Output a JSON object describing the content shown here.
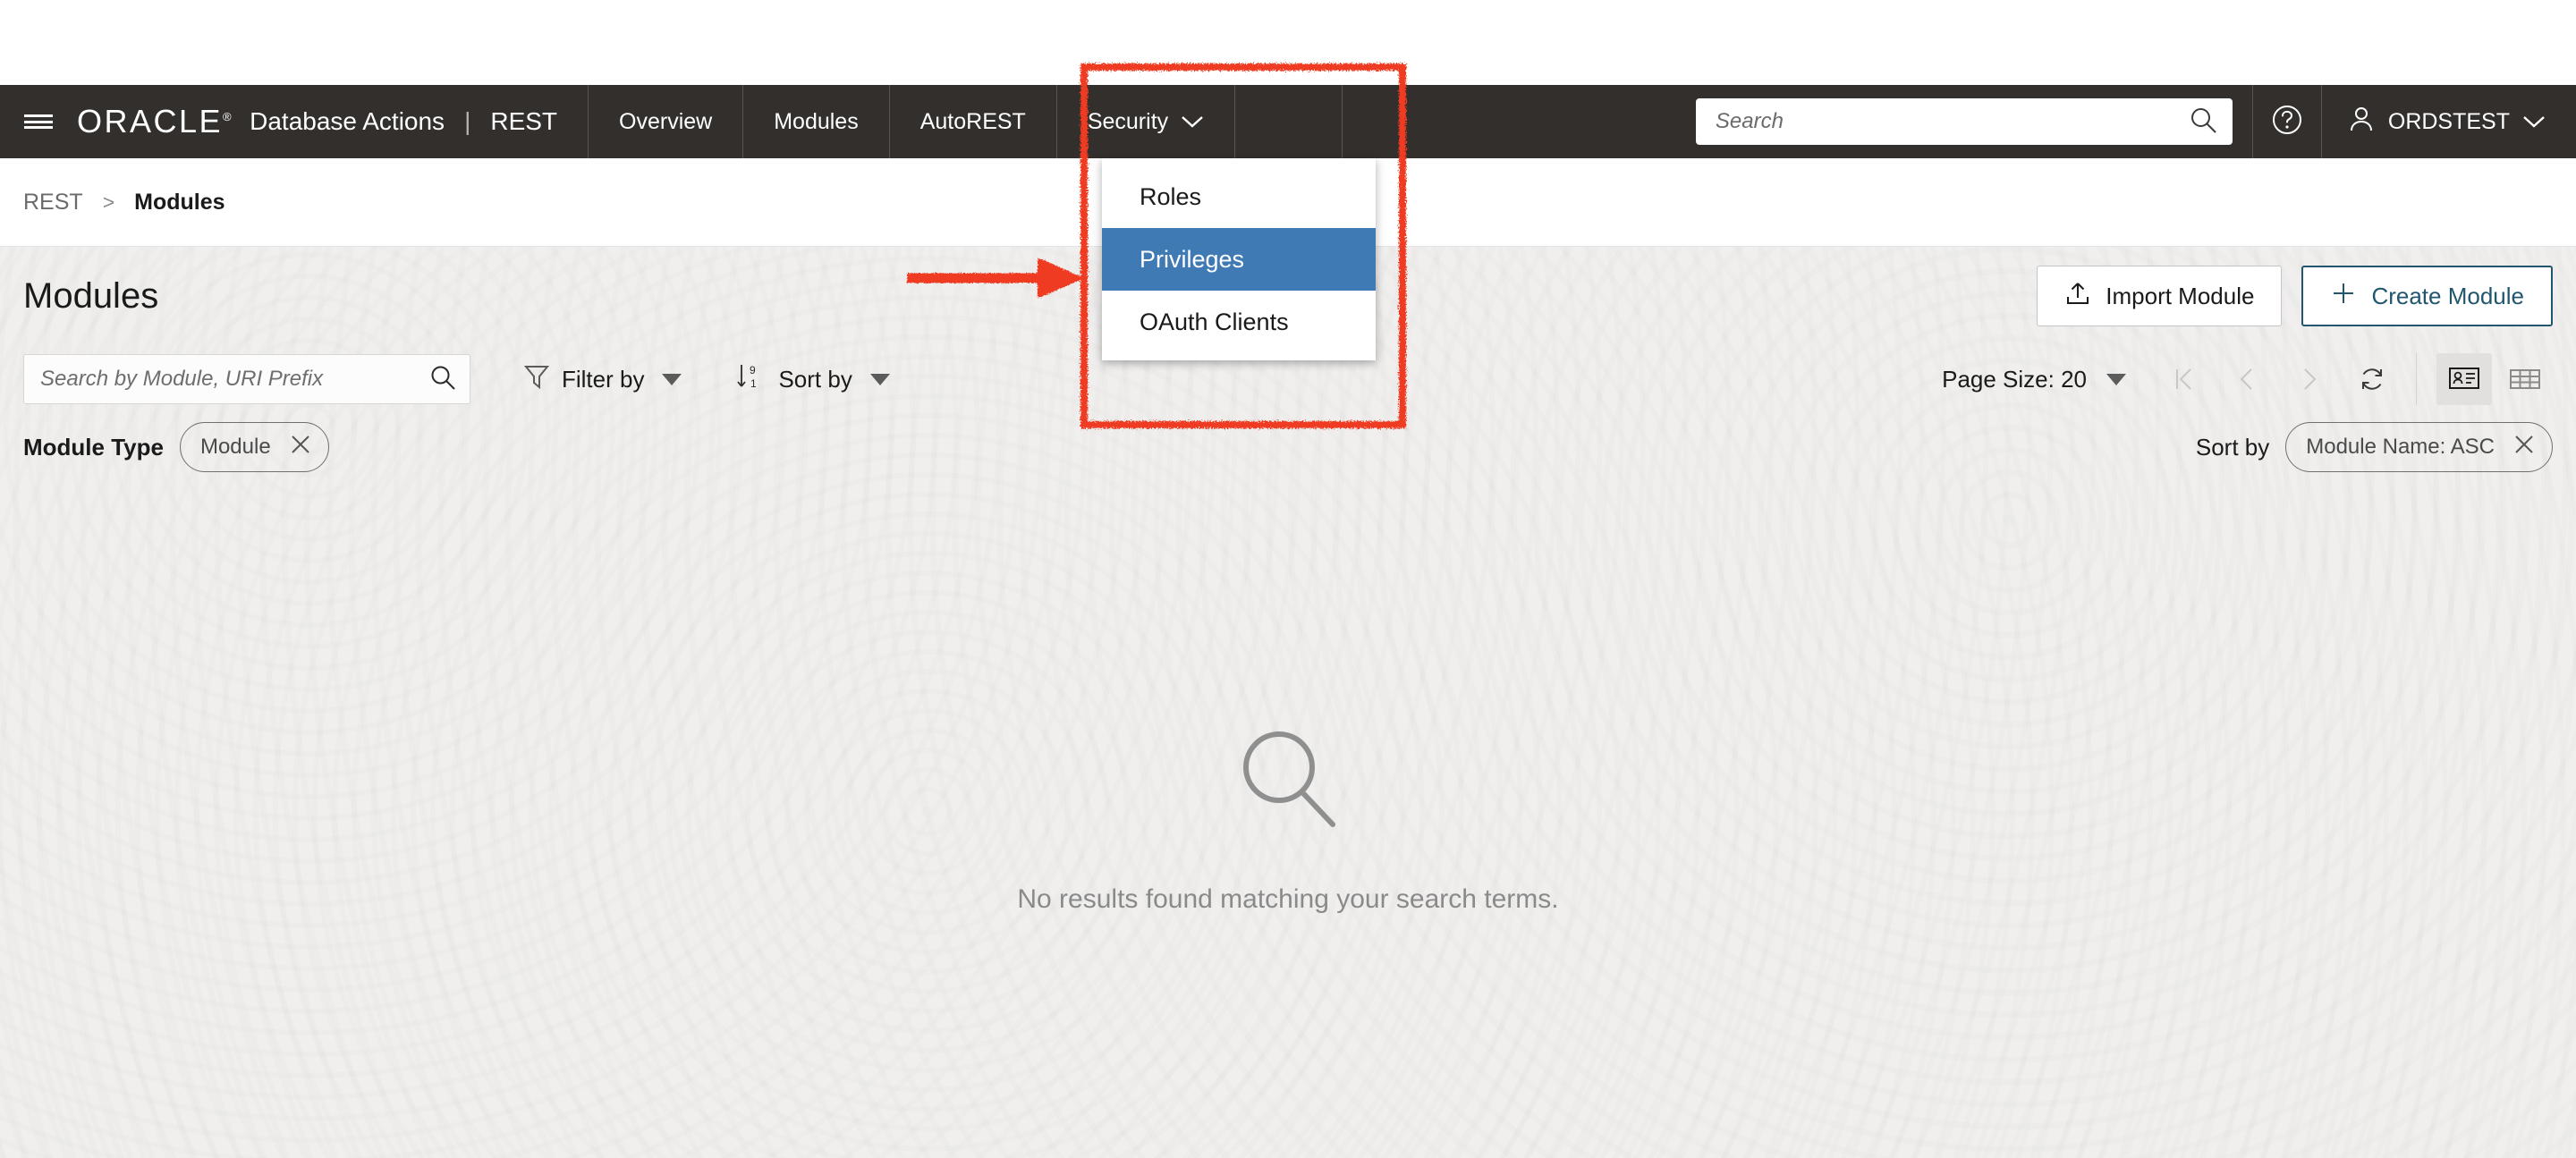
{
  "header": {
    "menu_icon": "hamburger-icon",
    "logo": "ORACLE",
    "logo_mark": "®",
    "product": "Database Actions",
    "divider": "|",
    "section": "REST",
    "tabs": [
      {
        "label": "Overview",
        "has_caret": false
      },
      {
        "label": "Modules",
        "has_caret": false
      },
      {
        "label": "AutoREST",
        "has_caret": false
      },
      {
        "label": "Security",
        "has_caret": true
      }
    ],
    "search": {
      "value": "",
      "placeholder": "Search",
      "icon": "search-icon"
    },
    "help_icon": "help-circle-icon",
    "user": {
      "name": "ORDSTEST",
      "icon": "user-icon",
      "caret": "chevron-down-icon"
    }
  },
  "security_menu": {
    "items": [
      {
        "label": "Roles",
        "active": false
      },
      {
        "label": "Privileges",
        "active": true
      },
      {
        "label": "OAuth Clients",
        "active": false
      }
    ],
    "highlight_color": "#3f7ab5"
  },
  "breadcrumb": {
    "root": "REST",
    "separator": ">",
    "current": "Modules"
  },
  "page": {
    "title": "Modules",
    "import_button": "Import Module",
    "import_icon": "upload-icon",
    "create_button": "Create Module",
    "create_icon": "plus-icon",
    "create_color": "#22566f"
  },
  "toolbar": {
    "search": {
      "value": "",
      "placeholder": "Search by Module, URI Prefix",
      "icon": "search-icon"
    },
    "filter_by": "Filter by",
    "filter_icon": "funnel-icon",
    "sort_by": "Sort by",
    "sort_icon": "sort-az-icon",
    "page_size_label": "Page Size: 20",
    "pagination": {
      "first": "first-page-icon",
      "prev": "previous-page-icon",
      "next": "next-page-icon",
      "refresh": "refresh-icon"
    },
    "views": [
      {
        "name": "card-view-icon",
        "selected": true
      },
      {
        "name": "table-view-icon",
        "selected": false
      }
    ]
  },
  "filters": {
    "module_type_label": "Module Type",
    "module_type_chip": "Module",
    "sort_by_label": "Sort by",
    "sort_by_chip": "Module Name: ASC",
    "remove_icon": "close-x-icon"
  },
  "empty_state": {
    "icon": "magnifier-icon",
    "message": "No results found matching your search terms."
  },
  "annotations": {
    "rect_color": "#ee3a21",
    "arrow_color": "#ee3a21"
  }
}
